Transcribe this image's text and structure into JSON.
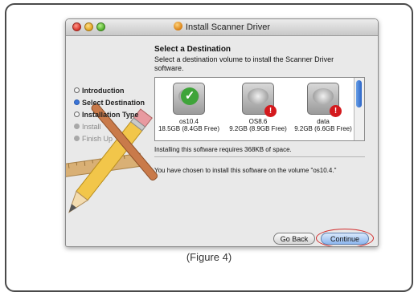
{
  "window": {
    "title": "Install Scanner Driver",
    "traffic_lights": [
      "close",
      "minimize",
      "zoom"
    ]
  },
  "sidebar": {
    "steps": [
      {
        "label": "Introduction",
        "state": "done"
      },
      {
        "label": "Select Destination",
        "state": "current"
      },
      {
        "label": "Installation Type",
        "state": "done"
      },
      {
        "label": "Install",
        "state": "pending"
      },
      {
        "label": "Finish Up",
        "state": "pending"
      }
    ]
  },
  "panel": {
    "title": "Select a Destination",
    "description": "Select a destination volume to install the Scanner Driver software.",
    "volumes": [
      {
        "name": "os10.4",
        "size": "18.5GB (8.4GB Free)",
        "icon": "green-check-disk-icon",
        "selected": true
      },
      {
        "name": "OS8.6",
        "size": "9.2GB (8.9GB Free)",
        "icon": "red-x-disk-icon",
        "selected": false
      },
      {
        "name": "data",
        "size": "9.2GB (6.6GB Free)",
        "icon": "red-x-disk-icon",
        "selected": false
      }
    ],
    "requirement": "Installing this software requires 368KB of space.",
    "chosen": "You have chosen to install this software on the volume \"os10.4.\""
  },
  "buttons": {
    "back": "Go Back",
    "continue": "Continue"
  },
  "caption": "(Figure 4)",
  "colors": {
    "accent": "#3a74d8",
    "highlight_ring": "#d22a2a",
    "check_badge": "#3fa43a",
    "error_badge": "#d4191d"
  }
}
